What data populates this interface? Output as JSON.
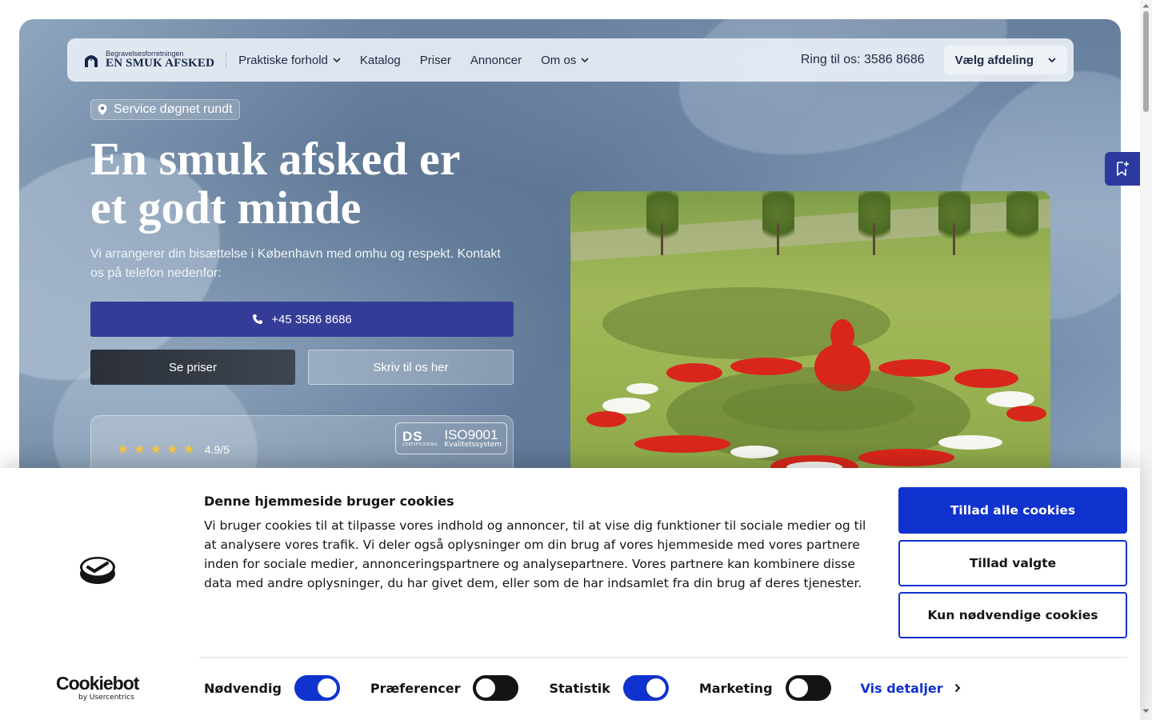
{
  "nav": {
    "logo_small": "Begravelsesforretningen",
    "logo_big": "EN SMUK AFSKED",
    "links": [
      {
        "label": "Praktiske forhold",
        "dropdown": true
      },
      {
        "label": "Katalog",
        "dropdown": false
      },
      {
        "label": "Priser",
        "dropdown": false
      },
      {
        "label": "Annoncer",
        "dropdown": false
      },
      {
        "label": "Om os",
        "dropdown": true
      }
    ],
    "phone": "Ring til os: 3586 8686",
    "department_button": "Vælg afdeling"
  },
  "hero": {
    "badge": "Service døgnet rundt",
    "headline_line1": "En smuk afsked er",
    "headline_line2": "et godt minde",
    "subtext": "Vi arrangerer din bisættelse i København med omhu og respekt. Kontakt os på telefon nedenfor:",
    "phone_button": "+45 3586 8686",
    "prices_button": "Se priser",
    "write_button": "Skriv til os her",
    "stars": "★ ★ ★ ★ ★",
    "rating": "4.9/5",
    "rating_value": 4.9,
    "cert_ds": "DS",
    "cert_ds_small": "CERTIFICERING",
    "cert_iso": "ISO9001",
    "cert_iso_small": "Kvalitetssystem"
  },
  "cookie": {
    "title": "Denne hjemmeside bruger cookies",
    "text": "Vi bruger cookies til at tilpasse vores indhold og annoncer, til at vise dig funktioner til sociale medier og til at analysere vores trafik. Vi deler også oplysninger om din brug af vores hjemmeside med vores partnere inden for sociale medier, annonceringspartnere og analysepartnere. Vores partnere kan kombinere disse data med andre oplysninger, du har givet dem, eller som de har indsamlet fra din brug af deres tjenester.",
    "allow_all": "Tillad alle cookies",
    "allow_selected": "Tillad valgte",
    "only_necessary": "Kun nødvendige cookies",
    "brand": "Cookiebot",
    "brand_sub": "by Usercentrics",
    "toggles": [
      {
        "label": "Nødvendig",
        "on": true
      },
      {
        "label": "Præferencer",
        "on": false
      },
      {
        "label": "Statistik",
        "on": true
      },
      {
        "label": "Marketing",
        "on": false
      }
    ],
    "details": "Vis detaljer"
  },
  "colors": {
    "primary_blue": "#1032cf",
    "hero_button": "#353c98",
    "navy_text": "#1e2a44",
    "star_gold": "#f5c542"
  }
}
